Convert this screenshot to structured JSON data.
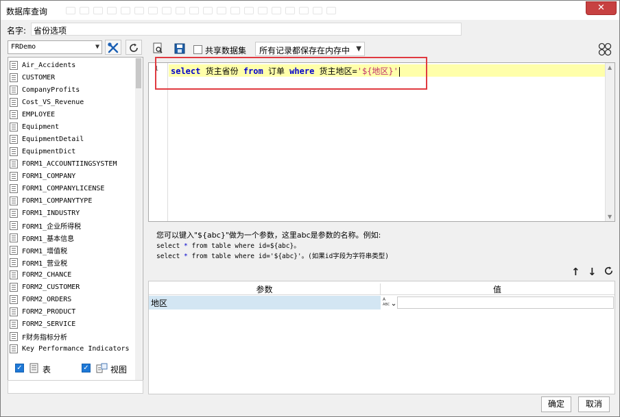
{
  "window": {
    "title": "数据库查询",
    "close_label": "✕"
  },
  "name_row": {
    "label": "名字:",
    "value": "省份选项"
  },
  "datasource": {
    "selected": "FRDemo"
  },
  "tables": [
    "Air_Accidents",
    "CUSTOMER",
    "CompanyProfits",
    "Cost_VS_Revenue",
    "EMPLOYEE",
    "Equipment",
    "EquipmentDetail",
    "EquipmentDict",
    "FORM1_ACCOUNTIINGSYSTEM",
    "FORM1_COMPANY",
    "FORM1_COMPANYLICENSE",
    "FORM1_COMPANYTYPE",
    "FORM1_INDUSTRY",
    "FORM1_企业所得税",
    "FORM1_基本信息",
    "FORM1_增值税",
    "FORM1_营业税",
    "FORM2_CHANCE",
    "FORM2_CUSTOMER",
    "FORM2_ORDERS",
    "FORM2_PRODUCT",
    "FORM2_SERVICE",
    "F财务指标分析",
    "Key Performance Indicators"
  ],
  "left_bottom": {
    "table_label": "表",
    "view_label": "视图",
    "table_checked": true,
    "view_checked": true
  },
  "toolbar": {
    "share_label": "共享数据集",
    "share_checked": false,
    "mode_selected": "所有记录都保存在内存中"
  },
  "editor": {
    "line_number": "1",
    "sql": {
      "kw_select": "select",
      "t1": " 货主省份 ",
      "kw_from": "from",
      "t2": " 订单 ",
      "kw_where": "where",
      "t3": " 货主地区=",
      "str": "'${地区}'"
    }
  },
  "hint": {
    "line1": "您可以键入\"${abc}\"做为一个参数，这里abc是参数的名称。例如:",
    "line2_a": "select ",
    "line2_star": "*",
    "line2_b": " from table where id=${abc}。",
    "line3_a": "select ",
    "line3_star": "*",
    "line3_b": " from table where id='${abc}'。(如果id字段为字符串类型)"
  },
  "param_table": {
    "headers": [
      "参数",
      "值"
    ],
    "rows": [
      {
        "name": "地区",
        "type_label": "A̵BC",
        "value": ""
      }
    ]
  },
  "footer": {
    "ok_label": "确定",
    "cancel_label": "取消"
  },
  "colors": {
    "highlight_border": "#e0393f",
    "current_line": "#ffffaa",
    "keyword": "#0000cc",
    "string": "#c0306a",
    "checkbox": "#1e78d6"
  }
}
